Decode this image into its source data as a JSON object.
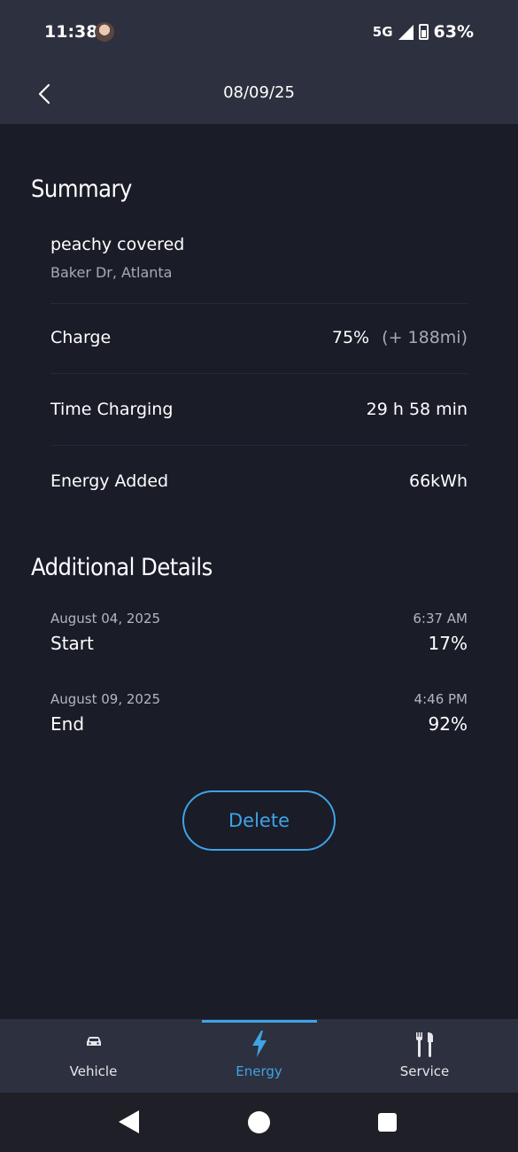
{
  "status_bar": {
    "time": "11:38",
    "network": "5G",
    "battery": "63%"
  },
  "header": {
    "title": "08/09/25"
  },
  "summary": {
    "heading": "Summary",
    "location_name": "peachy covered",
    "location_address": "Baker Dr, Atlanta",
    "rows": [
      {
        "label": "Charge",
        "value": "75%",
        "extra": "(+ 188mi)"
      },
      {
        "label": "Time Charging",
        "value": "29 h 58 min"
      },
      {
        "label": "Energy Added",
        "value": "66kWh"
      }
    ]
  },
  "additional": {
    "heading": "Additional Details",
    "entries": [
      {
        "date": "August 04, 2025",
        "time": "6:37 AM",
        "label": "Start",
        "percent": "17%"
      },
      {
        "date": "August 09, 2025",
        "time": "4:46 PM",
        "label": "End",
        "percent": "92%"
      }
    ]
  },
  "delete_label": "Delete",
  "tabs": [
    {
      "label": "Vehicle",
      "icon": "car-icon",
      "active": false
    },
    {
      "label": "Energy",
      "icon": "lightning-icon",
      "active": true
    },
    {
      "label": "Service",
      "icon": "tools-icon",
      "active": false
    }
  ],
  "colors": {
    "accent": "#3ea4e6",
    "background": "#1a1c28",
    "bar": "#2d303e"
  }
}
